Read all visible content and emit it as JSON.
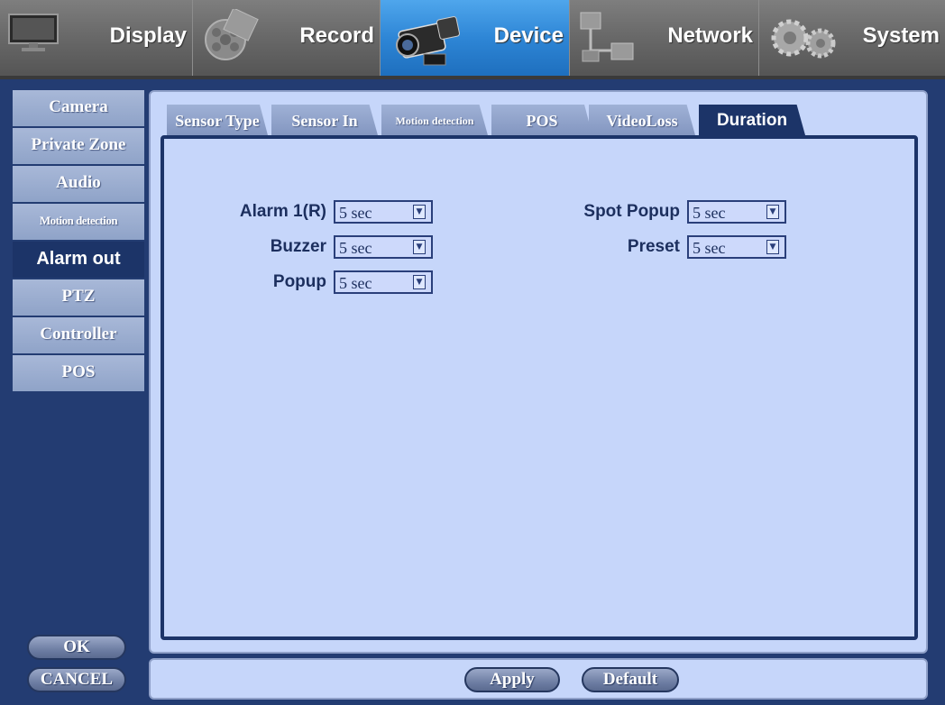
{
  "top_menu": [
    {
      "label": "Display",
      "icon": "monitor-icon"
    },
    {
      "label": "Record",
      "icon": "film-reel-icon"
    },
    {
      "label": "Device",
      "icon": "camcorder-icon",
      "active": true
    },
    {
      "label": "Network",
      "icon": "network-icon"
    },
    {
      "label": "System",
      "icon": "gears-icon"
    }
  ],
  "side_menu": [
    {
      "label": "Camera"
    },
    {
      "label": "Private Zone"
    },
    {
      "label": "Audio"
    },
    {
      "label": "Motion detection"
    },
    {
      "label": "Alarm out",
      "active": true
    },
    {
      "label": "PTZ"
    },
    {
      "label": "Controller"
    },
    {
      "label": "POS"
    }
  ],
  "tabs": [
    {
      "label": "Sensor Type"
    },
    {
      "label": "Sensor In"
    },
    {
      "label": "Motion detection"
    },
    {
      "label": "POS"
    },
    {
      "label": "VideoLoss"
    },
    {
      "label": "Duration",
      "active": true
    }
  ],
  "fields": {
    "alarm1": {
      "label": "Alarm 1(R)",
      "value": "5 sec"
    },
    "buzzer": {
      "label": "Buzzer",
      "value": "5 sec"
    },
    "popup": {
      "label": "Popup",
      "value": "5 sec"
    },
    "spot_popup": {
      "label": "Spot Popup",
      "value": "5 sec"
    },
    "preset": {
      "label": "Preset",
      "value": "5 sec"
    }
  },
  "buttons": {
    "ok": "OK",
    "cancel": "CANCEL",
    "apply": "Apply",
    "default": "Default"
  },
  "colors": {
    "active_top": "#2e86d6",
    "active_side": "#1c3468",
    "panel_bg": "#c6d6fa",
    "label_text": "#1c2f5e"
  }
}
